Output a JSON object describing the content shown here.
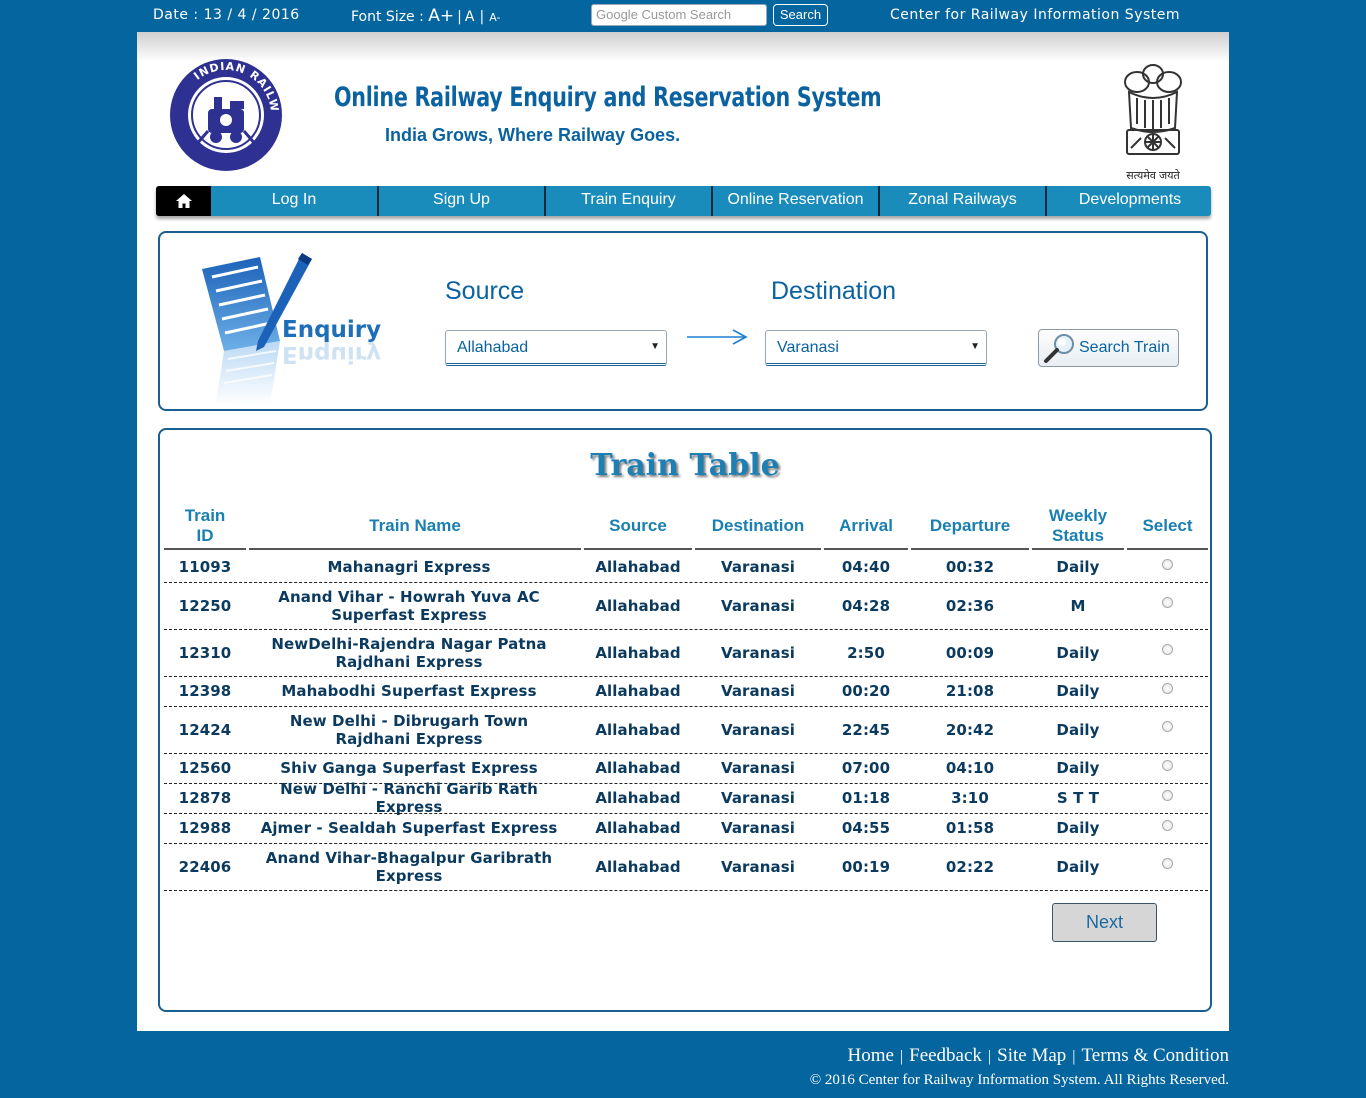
{
  "topbar": {
    "date": "Date : 13 / 4 / 2016",
    "font_size_label": "Font Size :",
    "font_large": "A+",
    "font_medium": "A",
    "font_small": "A-",
    "search_placeholder": "Google Custom Search",
    "search_button": "Search",
    "org_name": "Center for Railway Information System"
  },
  "header": {
    "title": "Online Railway Enquiry and Reservation System",
    "tagline": "India Grows, Where Railway Goes.",
    "logo_text": "INDIAN RAILWAYS",
    "emblem_motto": "सत्यमेव जयते"
  },
  "nav": {
    "items": [
      "Log In",
      "Sign Up",
      "Train Enquiry",
      "Online Reservation",
      "Zonal Railways",
      "Developments"
    ]
  },
  "enquiry": {
    "illustration_label": "Enquiry",
    "source_label": "Source",
    "destination_label": "Destination",
    "source_value": "Allahabad",
    "destination_value": "Varanasi",
    "search_button": "Search Train"
  },
  "train_table": {
    "title": "Train Table",
    "headers": [
      "Train ID",
      "Train Name",
      "Source",
      "Destination",
      "Arrival",
      "Departure",
      "Weekly Status",
      "Select"
    ],
    "rows": [
      {
        "id": "11093",
        "name": "Mahanagri Express",
        "source": "Allahabad",
        "destination": "Varanasi",
        "arrival": "04:40",
        "departure": "00:32",
        "weekly": "Daily"
      },
      {
        "id": "12250",
        "name": "Anand Vihar - Howrah Yuva AC Superfast Express",
        "source": "Allahabad",
        "destination": "Varanasi",
        "arrival": "04:28",
        "departure": "02:36",
        "weekly": "M"
      },
      {
        "id": "12310",
        "name": "NewDelhi-Rajendra Nagar Patna Rajdhani Express",
        "source": "Allahabad",
        "destination": "Varanasi",
        "arrival": "2:50",
        "departure": "00:09",
        "weekly": "Daily"
      },
      {
        "id": "12398",
        "name": "Mahabodhi Superfast Express",
        "source": "Allahabad",
        "destination": "Varanasi",
        "arrival": "00:20",
        "departure": "21:08",
        "weekly": "Daily"
      },
      {
        "id": "12424",
        "name": "New Delhi - Dibrugarh Town Rajdhani Express",
        "source": "Allahabad",
        "destination": "Varanasi",
        "arrival": "22:45",
        "departure": "20:42",
        "weekly": "Daily"
      },
      {
        "id": "12560",
        "name": "Shiv Ganga Superfast Express",
        "source": "Allahabad",
        "destination": "Varanasi",
        "arrival": "07:00",
        "departure": "04:10",
        "weekly": "Daily"
      },
      {
        "id": "12878",
        "name": "New Delhi - Ranchi Garib Rath Express",
        "source": "Allahabad",
        "destination": "Varanasi",
        "arrival": "01:18",
        "departure": "3:10",
        "weekly": "S T T"
      },
      {
        "id": "12988",
        "name": "Ajmer - Sealdah Superfast Express",
        "source": "Allahabad",
        "destination": "Varanasi",
        "arrival": "04:55",
        "departure": "01:58",
        "weekly": "Daily"
      },
      {
        "id": "22406",
        "name": "Anand Vihar-Bhagalpur Garibrath Express",
        "source": "Allahabad",
        "destination": "Varanasi",
        "arrival": "00:19",
        "departure": "02:22",
        "weekly": "Daily"
      }
    ],
    "next_button": "Next"
  },
  "footer": {
    "links": [
      "Home",
      "Feedback",
      "Site Map",
      "Terms & Condition"
    ],
    "copyright": "© 2016 Center for Railway Information System. All Rights Reserved."
  },
  "colors": {
    "page_bg": "#05659e",
    "nav_bg": "#1a8cbc",
    "accent_text": "#0a62a0",
    "table_text": "#0b3a5e"
  }
}
